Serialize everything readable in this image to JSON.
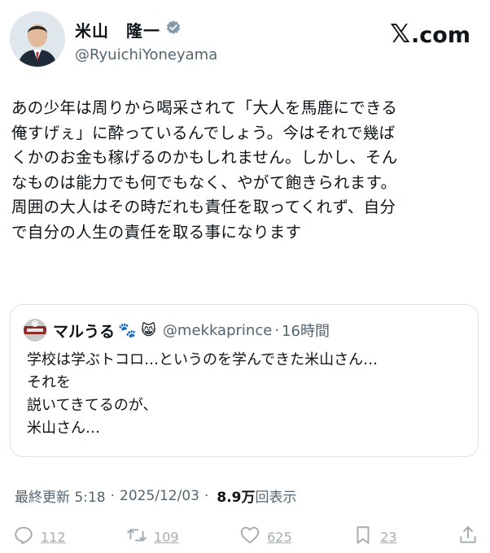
{
  "author": {
    "display_name": "米山　隆一",
    "handle": "@RyuichiYoneyama"
  },
  "brand": {
    "x": "𝕏",
    "suffix": ".com"
  },
  "tweet": {
    "text": "あの少年は周りから喝采されて「大人を馬鹿にできる\n俺すげぇ」に酔っているんでしょう。今はそれで幾ば\nくかのお金も稼げるのかもしれません。しかし、そん\nなものは能力でも何でもなく、やがて飽きられます。\n周囲の大人はその時だれも責任を取ってくれず、自分\nで自分の人生の責任を取る事になります"
  },
  "quote": {
    "display_name": "マルうる",
    "emoji": "🐾 😸",
    "handle": "@mekkaprince",
    "dot": "·",
    "time": "16時間",
    "text": "学校は学ぶトコロ…というのを学んできた米山さん…\nそれを\n説いてきてるのが、\n米山さん…"
  },
  "meta": {
    "edited_label": "最終更新 5:18",
    "sep": "·",
    "date": "2025/12/03",
    "sep2": "·",
    "views_num": "8.9万",
    "views_label": "回表示"
  },
  "actions": {
    "replies": "112",
    "retweets": "109",
    "likes": "625",
    "bookmarks": "23"
  },
  "icons": {
    "verified": "verified-badge-icon",
    "reply": "reply-icon",
    "retweet": "retweet-icon",
    "like": "heart-icon",
    "bookmark": "bookmark-icon",
    "share": "share-icon"
  },
  "colors": {
    "text": "#0f1419",
    "secondary": "#536471",
    "action": "#a4acb3",
    "border": "#dde3e8"
  }
}
